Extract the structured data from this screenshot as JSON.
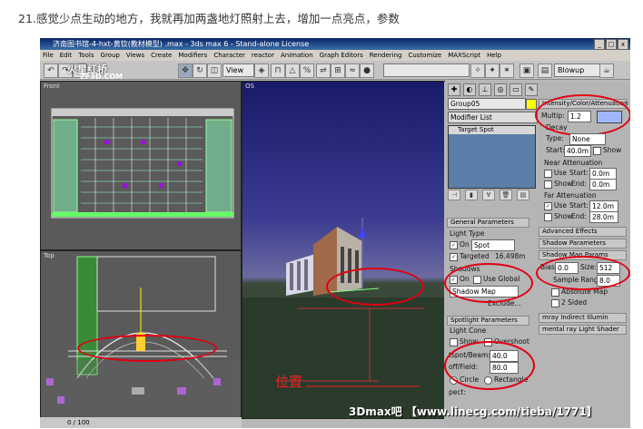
{
  "caption": "21.感觉少点生动的地方，我就再加两盏地灯照射上去，增加一点亮点，参数",
  "window": {
    "title": "济南图书馆-4-hxt-黄钦(教材模型) .max - 3ds max 6 - Stand-alone License",
    "min": "_",
    "max": "□",
    "close": "x"
  },
  "menu": [
    "File",
    "Edit",
    "Tools",
    "Group",
    "Views",
    "Create",
    "Modifiers",
    "Character",
    "reactor",
    "Animation",
    "Graph Editors",
    "Rendering",
    "Customize",
    "MAXScript",
    "Help"
  ],
  "toolbar": {
    "view_select": "View",
    "blowup_select": "Blowup"
  },
  "watermark_logo": {
    "top": "火星红桥",
    "bottom": "ZF3D.COM"
  },
  "viewports": {
    "front": "Front",
    "top": "Top",
    "persp": "OS"
  },
  "scene_text": "位置",
  "status": {
    "frames": "0 / 100"
  },
  "bottom_watermark": "3Dmax吧 【www.linecg.com/tieba/1771】",
  "panel": {
    "object_name": "Group05",
    "modifier_list": "Modifier List",
    "stack_item": "Target Spot",
    "general": {
      "header": "General Parameters",
      "light_type": "Light Type",
      "on": "On",
      "type_value": "Spot",
      "targeted": "Targeted",
      "target_dist": "16.498m",
      "shadows": "Shadows",
      "use_global": "Use Global",
      "shadow_type": "Shadow Map",
      "exclude": "Exclude..."
    },
    "spot": {
      "header": "Spotlight Parameters",
      "light_cone": "Light Cone",
      "show": "Show",
      "overshoot": "Overshoot",
      "hotspot_label": "tspot/Beam:",
      "hotspot": "40.0",
      "falloff_label": "off/Field:",
      "falloff": "80.0",
      "circle": "Circle",
      "rectangle": "Rectangle",
      "aspect_label": "pect:"
    },
    "intensity": {
      "header": "Intensity/Color/Attenuation",
      "multiplier_label": "Multip:",
      "multiplier": "1.2",
      "color": "#9fb7ff",
      "decay": "Decay",
      "type_label": "Type:",
      "type_value": "None",
      "start_label": "Start:",
      "start": "40.0m",
      "show": "Show"
    },
    "near": {
      "header": "Near Attenuation",
      "use": "Use",
      "start_label": "Start:",
      "start": "0.0m",
      "show": "Show",
      "end_label": "End:",
      "end": "0.0m"
    },
    "far": {
      "header": "Far Attenuation",
      "use": "Use",
      "start_label": "Start:",
      "start": "12.0m",
      "show": "Show",
      "end_label": "End:",
      "end": "28.0m"
    },
    "rollouts": {
      "advanced": "Advanced Effects",
      "shadow_params": "Shadow Parameters",
      "shadow_map": "Shadow Map Params"
    },
    "shadowmap": {
      "bias_label": "Bias:",
      "bias": "0.0",
      "size_label": "Size:",
      "size": "512",
      "sample_label": "Sample Range:",
      "sample": "8.0",
      "absolute": "Absolute Map",
      "two_sided": "2 Sided"
    },
    "mray_indirect": "mray Indirect Illumin",
    "mental_shader": "mental ray Light Shader"
  },
  "colors": {
    "annotation": "#e00012",
    "viewport_bg": "#5a5a5a",
    "persp_sky": "#2a2a7a"
  }
}
